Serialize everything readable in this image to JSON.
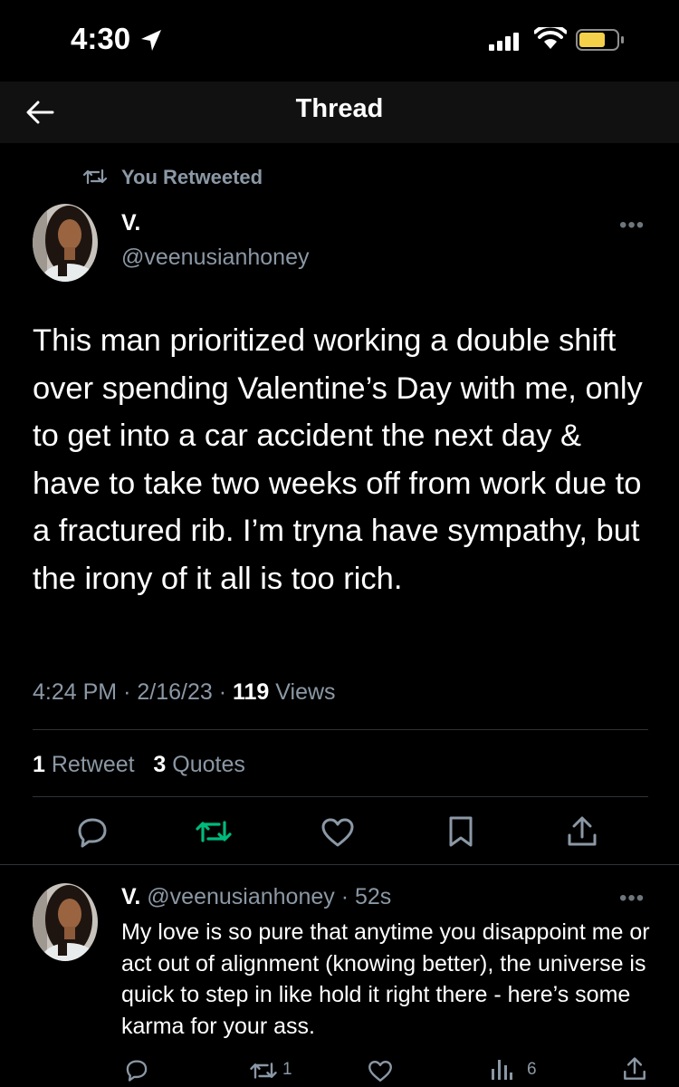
{
  "status_bar": {
    "time": "4:30"
  },
  "header": {
    "title": "Thread"
  },
  "retweet_context": {
    "label": "You Retweeted"
  },
  "main_tweet": {
    "author_name": "V.",
    "author_handle": "@veenusianhoney",
    "text": "This man prioritized working a double shift over spending Valentine’s Day with me, only to get into a car accident the next day & have to take two weeks off from work due to a fractured rib. I’m tryna have sympathy, but the irony of it all is too rich.",
    "time": "4:24 PM",
    "date": "2/16/23",
    "views_count": "119",
    "views_label": "Views",
    "retweet_count": "1",
    "retweet_label": "Retweet",
    "quote_count": "3",
    "quote_label": "Quotes"
  },
  "reply_tweet": {
    "author_name": "V.",
    "author_handle": "@veenusianhoney",
    "age": "52s",
    "text": "My love is so pure that anytime you disappoint me or act out of alignment (knowing better), the universe is quick to step in like hold it right there - here’s some karma for your ass.",
    "retweet_count": "1",
    "views_count": "6"
  },
  "icons": {
    "back": "back-arrow-icon",
    "location": "location-arrow-icon",
    "signal": "cellular-signal-icon",
    "wifi": "wifi-icon",
    "battery": "battery-icon",
    "retweet": "retweet-icon",
    "reply": "reply-icon",
    "like": "heart-icon",
    "bookmark": "bookmark-icon",
    "share": "share-icon",
    "views": "views-icon",
    "more": "more-options-icon"
  },
  "colors": {
    "background": "#000000",
    "text_primary": "#ffffff",
    "text_secondary": "#8b98a5",
    "retweet_active": "#00ba7c",
    "battery_low": "#f5d04a",
    "divider": "#2f3336"
  }
}
